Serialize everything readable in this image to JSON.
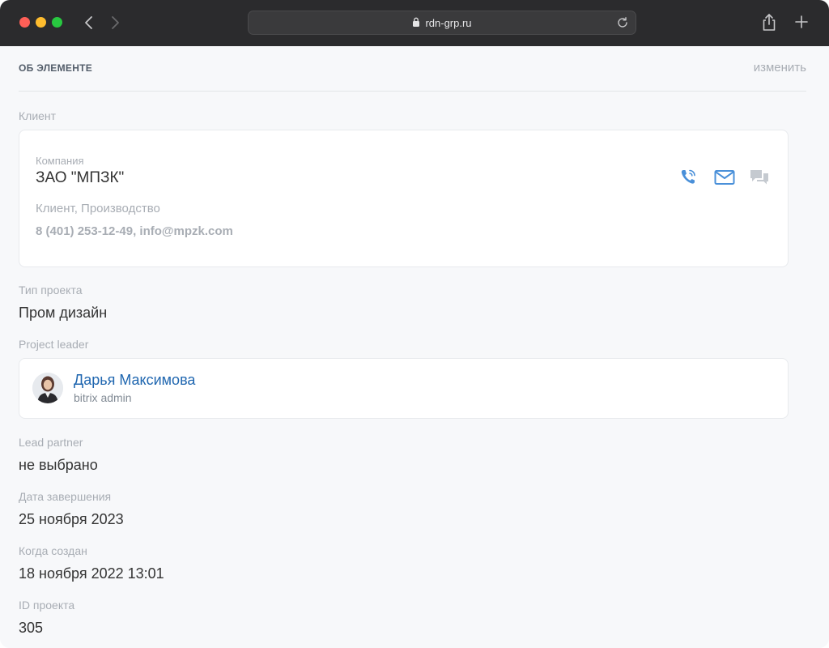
{
  "browser": {
    "url": "rdn-grp.ru",
    "icons": [
      "back-arrow-icon",
      "forward-arrow-icon",
      "lock-icon",
      "reload-icon",
      "share-icon",
      "plus-icon"
    ]
  },
  "section": {
    "title": "ОБ ЭЛЕМЕНТЕ",
    "edit_label": "изменить"
  },
  "client": {
    "label": "Клиент",
    "company_label": "Компания",
    "company_name": "ЗАО \"МПЗК\"",
    "categories": "Клиент, Производство",
    "contacts": "8 (401) 253-12-49, info@mpzk.com",
    "action_icons": [
      "phone-icon",
      "mail-icon",
      "chat-icon"
    ]
  },
  "project_type": {
    "label": "Тип проекта",
    "value": "Пром дизайн"
  },
  "project_leader": {
    "label": "Project leader",
    "name": "Дарья Максимова",
    "role": "bitrix admin"
  },
  "lead_partner": {
    "label": "Lead partner",
    "value": "не выбрано"
  },
  "end_date": {
    "label": "Дата завершения",
    "value": "25 ноября 2023"
  },
  "created": {
    "label": "Когда создан",
    "value": "18 ноября 2022 13:01"
  },
  "project_id": {
    "label": "ID проекта",
    "value": "305"
  },
  "colors": {
    "link": "#2067b0",
    "icon_blue": "#4a90d9",
    "icon_gray": "#c5cad0",
    "muted": "#a8adb4"
  }
}
